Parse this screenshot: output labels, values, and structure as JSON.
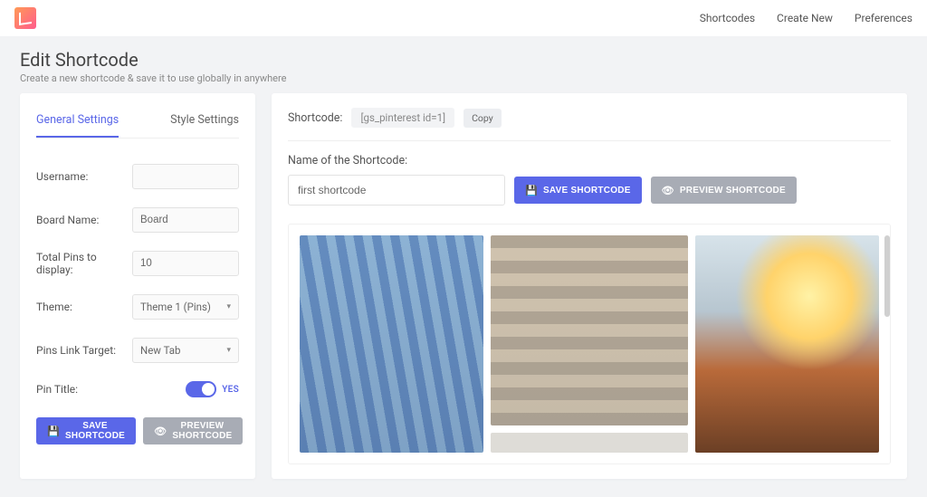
{
  "nav": {
    "items": [
      {
        "label": "Shortcodes"
      },
      {
        "label": "Create New"
      },
      {
        "label": "Preferences"
      }
    ]
  },
  "page": {
    "title": "Edit Shortcode",
    "subtitle": "Create a new shortcode & save it to use globally in anywhere"
  },
  "tabs": {
    "general": "General Settings",
    "style": "Style Settings"
  },
  "settings": {
    "username_label": "Username:",
    "username_value": "",
    "board_label": "Board Name:",
    "board_value": "Board",
    "total_label": "Total Pins to display:",
    "total_value": "10",
    "theme_label": "Theme:",
    "theme_value": "Theme 1 (Pins)",
    "target_label": "Pins Link Target:",
    "target_value": "New Tab",
    "pintitle_label": "Pin Title:",
    "pintitle_state": "YES"
  },
  "buttons": {
    "save": "SAVE SHORTCODE",
    "preview": "PREVIEW SHORTCODE",
    "copy": "Copy"
  },
  "shortcode": {
    "label": "Shortcode:",
    "code": "[gs_pinterest id=1]",
    "name_label": "Name of the Shortcode:",
    "name_value": "first shortcode"
  }
}
